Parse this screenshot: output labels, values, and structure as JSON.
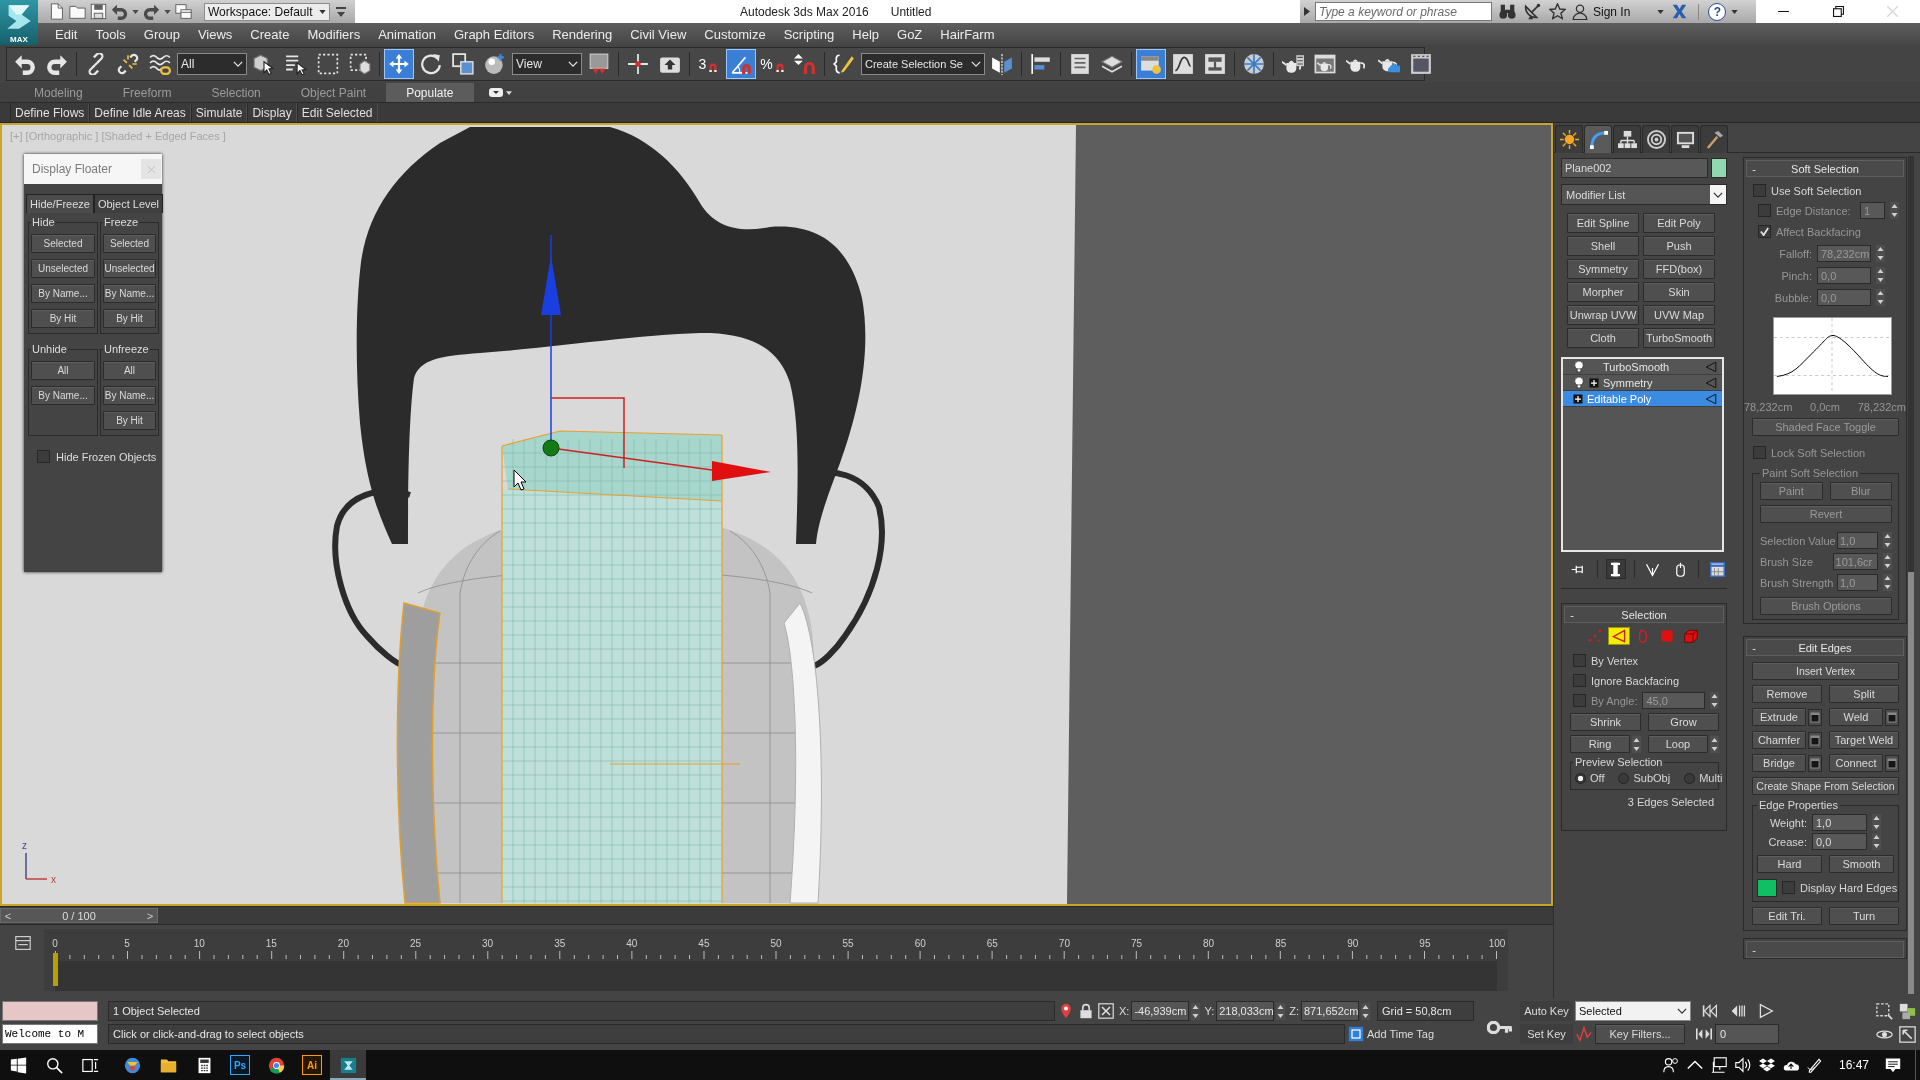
{
  "title_bar": {
    "app_button": "MAX",
    "quick_access": [
      {
        "kind": "new"
      },
      {
        "kind": "open"
      },
      {
        "kind": "save"
      },
      {
        "kind": "undo"
      },
      {
        "kind": "redo"
      },
      {
        "kind": "project"
      }
    ],
    "workspace": "Workspace: Default",
    "title": "Autodesk 3ds Max 2016",
    "document": "Untitled",
    "search": {
      "placeholder": "Type a keyword or phrase"
    },
    "tools": [
      {
        "kind": "binoculars"
      },
      {
        "kind": "satellite"
      },
      {
        "kind": "star"
      }
    ],
    "sign_in": "Sign In",
    "help": "?"
  },
  "menu": [
    "Edit",
    "Tools",
    "Group",
    "Views",
    "Create",
    "Modifiers",
    "Animation",
    "Graph Editors",
    "Rendering",
    "Civil View",
    "Customize",
    "Scripting",
    "Help",
    "GoZ",
    "HairFarm"
  ],
  "toolbar": [
    {
      "kind": "undo",
      "selected": false
    },
    {
      "kind": "redo",
      "selected": false
    },
    {
      "kind": "separator"
    },
    {
      "kind": "link",
      "selected": false
    },
    {
      "kind": "unlink",
      "selected": false
    },
    {
      "kind": "bind",
      "selected": false
    },
    {
      "kind": "dropdown",
      "value": "All"
    },
    {
      "kind": "select",
      "selected": false
    },
    {
      "kind": "byname",
      "selected": false
    },
    {
      "kind": "rect",
      "selected": false
    },
    {
      "kind": "window",
      "selected": false
    },
    {
      "kind": "separator"
    },
    {
      "kind": "move",
      "selected": true
    },
    {
      "kind": "rotate",
      "selected": false
    },
    {
      "kind": "scale",
      "selected": false
    },
    {
      "kind": "place",
      "selected": false
    },
    {
      "kind": "dropdown",
      "value": "View"
    },
    {
      "kind": "pivot",
      "selected": false
    },
    {
      "kind": "separator"
    },
    {
      "kind": "manipulate",
      "selected": false
    },
    {
      "kind": "keyboard",
      "selected": false
    },
    {
      "kind": "separator"
    },
    {
      "kind": "snap",
      "label": "3",
      "selected": false
    },
    {
      "kind": "anglesnap",
      "selected": true
    },
    {
      "kind": "snap",
      "label": "%",
      "selected": false
    },
    {
      "kind": "spinnersnap",
      "selected": false
    },
    {
      "kind": "separator"
    },
    {
      "kind": "namedsel",
      "selected": false
    },
    {
      "kind": "dropdown",
      "value": "Create Selection Se"
    },
    {
      "kind": "mirror",
      "selected": false
    },
    {
      "kind": "separator"
    },
    {
      "kind": "align",
      "selected": false
    },
    {
      "kind": "separator"
    },
    {
      "kind": "sceneexp",
      "selected": false
    },
    {
      "kind": "layers",
      "selected": false
    },
    {
      "kind": "separator"
    },
    {
      "kind": "ribbon",
      "selected": true
    },
    {
      "kind": "curve",
      "selected": false
    },
    {
      "kind": "schematic",
      "selected": false
    },
    {
      "kind": "separator"
    },
    {
      "kind": "material",
      "selected": false
    },
    {
      "kind": "separator"
    },
    {
      "kind": "rendersetup",
      "selected": false
    },
    {
      "kind": "renderframe",
      "selected": false
    },
    {
      "kind": "render",
      "selected": false
    },
    {
      "kind": "rendercloud",
      "selected": false
    },
    {
      "kind": "renderwin",
      "selected": false
    }
  ],
  "ribbon": {
    "tabs": [
      {
        "label": "Modeling",
        "selected": false
      },
      {
        "label": "Freeform",
        "selected": false
      },
      {
        "label": "Selection",
        "selected": false
      },
      {
        "label": "Object Paint",
        "selected": false
      },
      {
        "label": "Populate",
        "selected": true
      }
    ],
    "panel": [
      "Define Flows",
      "Define Idle Areas",
      "Simulate",
      "Display",
      "Edit Selected"
    ]
  },
  "viewport": {
    "label": "[+] [Orthographic ] [Shaded + Edged Faces ]",
    "active": true,
    "axis_labels": [
      "z",
      "x"
    ]
  },
  "display_floater": {
    "title": "Display Floater",
    "tabs": [
      {
        "label": "Hide/Freeze",
        "selected": true
      },
      {
        "label": "Object Level",
        "selected": false
      }
    ],
    "groups": [
      {
        "title": "Hide",
        "buttons": [
          "Selected",
          "Unselected",
          "By Name...",
          "By Hit"
        ]
      },
      {
        "title": "Freeze",
        "buttons": [
          "Selected",
          "Unselected",
          "By Name...",
          "By Hit"
        ]
      },
      {
        "title": "Unhide",
        "buttons": [
          "All",
          "By Name..."
        ]
      },
      {
        "title": "Unfreeze",
        "buttons": [
          "All",
          "By Name...",
          "By Hit"
        ]
      }
    ],
    "option": {
      "label": "Hide Frozen Objects",
      "checked": false
    }
  },
  "time_slider": {
    "previous": "<",
    "position": "0 / 100",
    "next": ">",
    "level": 0
  },
  "track_bar": {
    "labels": [
      "0",
      "5",
      "10",
      "15",
      "20",
      "25",
      "30",
      "35",
      "40",
      "45",
      "50",
      "55",
      "60",
      "65",
      "70",
      "75",
      "80",
      "85",
      "90",
      "95",
      "100"
    ]
  },
  "command_panel": {
    "tabs": [
      {
        "kind": "create",
        "selected": false
      },
      {
        "kind": "modify",
        "selected": true
      },
      {
        "kind": "hierarchy",
        "selected": false
      },
      {
        "kind": "motion",
        "selected": false
      },
      {
        "kind": "display",
        "selected": false
      },
      {
        "kind": "utilities",
        "selected": false
      }
    ],
    "object_name": "Plane002",
    "modifier_list": "Modifier List",
    "modifier_buttons": [
      "Edit Spline",
      "Edit Poly",
      "Shell",
      "Push",
      "Symmetry",
      "FFD(box)",
      "Morpher",
      "Skin",
      "Unwrap UVW",
      "UVW Map",
      "Cloth",
      "TurboSmooth"
    ],
    "modifier_stack": [
      {
        "label": "TurboSmooth",
        "kind": "modifier",
        "on": true,
        "expandable": false,
        "selected": false
      },
      {
        "label": "Symmetry",
        "kind": "modifier",
        "on": true,
        "expandable": true,
        "selected": false
      },
      {
        "label": "Editable Poly",
        "kind": "object",
        "expandable": true,
        "selected": true
      }
    ],
    "stack_tools": [
      {
        "kind": "pin",
        "selected": false
      },
      {
        "kind": "endresult",
        "selected": true
      },
      {
        "kind": "unique",
        "selected": false
      },
      {
        "kind": "remove",
        "selected": false
      },
      {
        "kind": "configure",
        "selected": false
      }
    ],
    "selection": {
      "toggle": "-",
      "title": "Selection",
      "levels": [
        {
          "kind": "vertex",
          "selected": false
        },
        {
          "kind": "edge",
          "selected": true
        },
        {
          "kind": "border",
          "selected": false
        },
        {
          "kind": "polygon",
          "selected": false
        },
        {
          "kind": "element",
          "selected": false
        }
      ],
      "options": [
        {
          "label": "By Vertex",
          "checked": false
        },
        {
          "label": "Ignore Backfacing",
          "checked": false
        }
      ],
      "by_angle": {
        "label": "By Angle:",
        "checked": false,
        "value": "45,0",
        "disabled": true
      },
      "grow_buttons": [
        "Shrink",
        "Grow"
      ],
      "loop_buttons": [
        "Ring",
        "Loop"
      ],
      "preview": {
        "title": "Preview Selection",
        "options": [
          {
            "label": "Off",
            "selected": true
          },
          {
            "label": "SubObj",
            "selected": false
          },
          {
            "label": "Multi",
            "selected": false
          }
        ]
      },
      "status": "3 Edges Selected"
    },
    "soft_selection": {
      "toggle": "-",
      "title": "Soft Selection",
      "disabled": true,
      "use": {
        "label": "Use Soft Selection",
        "checked": false
      },
      "edge_distance": {
        "label": "Edge Distance:",
        "checked": false,
        "value": "1"
      },
      "affect_backfacing": {
        "label": "Affect Backfacing",
        "checked": true
      },
      "fields": [
        {
          "label": "Falloff:",
          "value": "78,232cm"
        },
        {
          "label": "Pinch:",
          "value": "0,0"
        },
        {
          "label": "Bubble:",
          "value": "0,0"
        }
      ],
      "curve_labels": [
        "78,232cm",
        "0,0cm",
        "78,232cm"
      ],
      "face_toggle": "Shaded Face Toggle",
      "lock": {
        "label": "Lock Soft Selection",
        "checked": false
      },
      "paint": {
        "title": "Paint Soft Selection",
        "buttons": [
          "Paint",
          "Blur"
        ],
        "revert": "Revert",
        "fields": [
          {
            "label": "Selection Value",
            "value": "1,0"
          },
          {
            "label": "Brush Size",
            "value": "101,6cr"
          },
          {
            "label": "Brush Strength",
            "value": "1,0"
          }
        ],
        "options": "Brush Options"
      }
    },
    "edit_edges": {
      "toggle": "-",
      "title": "Edit Edges",
      "rows": [
        [
          {
            "label": "Insert Vertex",
            "settings": false
          }
        ],
        [
          {
            "label": "Remove",
            "settings": false
          },
          {
            "label": "Split",
            "settings": false
          }
        ],
        [
          {
            "label": "Extrude",
            "settings": true
          },
          {
            "label": "Weld",
            "settings": true
          }
        ],
        [
          {
            "label": "Chamfer",
            "settings": true
          },
          {
            "label": "Target Weld",
            "settings": false
          }
        ],
        [
          {
            "label": "Bridge",
            "settings": true
          },
          {
            "label": "Connect",
            "settings": true
          }
        ],
        [
          {
            "label": "Create Shape From Selection",
            "settings": false
          }
        ]
      ],
      "properties": {
        "title": "Edge Properties",
        "fields": [
          {
            "label": "Weight:",
            "value": "1,0"
          },
          {
            "label": "Crease:",
            "value": "0,0"
          }
        ],
        "buttons": [
          "Hard",
          "Smooth"
        ],
        "display_hard_edges": {
          "label": "Display Hard Edges",
          "checked": false
        }
      },
      "bottom_buttons": [
        "Edit Tri.",
        "Turn"
      ]
    },
    "next_rollout": {
      "toggle": "-"
    }
  },
  "status_bar": {
    "listener_output": "Welcome to M",
    "selection": "1 Object Selected",
    "prompt": "Click or click-and-drag to select objects",
    "coords": [
      {
        "label": "X:",
        "value": "-46,939cm"
      },
      {
        "label": "Y:",
        "value": "218,033cm"
      },
      {
        "label": "Z:",
        "value": "871,652cm"
      }
    ],
    "grid": "Grid = 50,8cm",
    "time_tag": "Add Time Tag",
    "auto_key": "Auto Key",
    "key_set": "Selected",
    "set_key": "Set Key",
    "key_filters": "Key Filters...",
    "frame": "0"
  },
  "taskbar": {
    "apps": [
      {
        "kind": "app",
        "active": false
      },
      {
        "kind": "folder",
        "active": false
      },
      {
        "kind": "calculator",
        "active": false
      },
      {
        "kind": "tile",
        "label": "Ps",
        "color": "#31a8ff",
        "active": false
      },
      {
        "kind": "browser",
        "active": false
      },
      {
        "kind": "tile",
        "label": "Ai",
        "color": "#ff9a00",
        "active": false
      },
      {
        "kind": "maxapp",
        "active": true
      }
    ],
    "clock": "16:47"
  }
}
